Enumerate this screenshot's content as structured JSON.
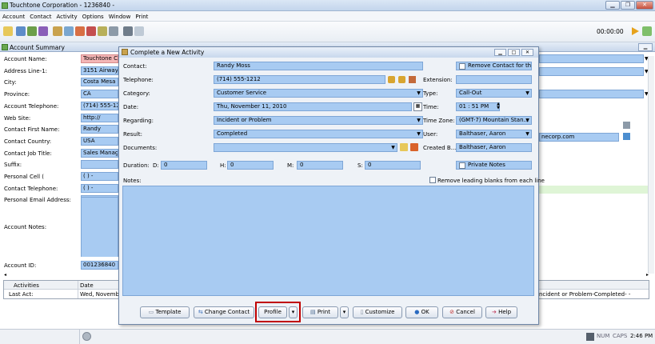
{
  "window": {
    "title": "Touchtone Corporation - 1236840 -"
  },
  "menu": [
    "Account",
    "Contact",
    "Activity",
    "Options",
    "Window",
    "Print"
  ],
  "toolbar": {
    "timer": "00:00:00"
  },
  "summary": {
    "title": "Account Summary",
    "fields": [
      {
        "label": "Account Name:",
        "value": "Touchtone Co"
      },
      {
        "label": "Address Line-1:",
        "value": "3151 Airway A"
      },
      {
        "label": "City:",
        "value": "Costa Mesa"
      },
      {
        "label": "Province:",
        "value": "CA"
      },
      {
        "label": "Account Telephone:",
        "value": "(714) 555-121"
      },
      {
        "label": "Web Site:",
        "value": "http://"
      },
      {
        "label": "Contact First Name:",
        "value": "Randy"
      },
      {
        "label": "Contact Country:",
        "value": "USA"
      },
      {
        "label": "Contact Job Title:",
        "value": "Sales Manager"
      },
      {
        "label": "Suffix:",
        "value": ""
      },
      {
        "label": "Personal Cell (",
        "value": "( )  -"
      },
      {
        "label": "Contact Telephone:",
        "value": "( )  -"
      },
      {
        "label": "Personal Email Address:",
        "value": ""
      }
    ],
    "notes_label": "Account Notes:",
    "account_id_label": "Account ID:",
    "account_id": "001236840",
    "email_partial": "necorp.com",
    "activities_header": "Activities",
    "date_header": "Date",
    "last_act_label": "Last Act:",
    "last_act_date": "Wed, Novembe",
    "last_act_desc": "ncident or Problem-Completed- -"
  },
  "dialog": {
    "title": "Complete a New Activity",
    "contact_label": "Contact:",
    "contact": "Randy Moss",
    "remove_contact": "Remove Contact for th...",
    "telephone_label": "Telephone:",
    "telephone": "(714) 555-1212",
    "extension_label": "Extension:",
    "category_label": "Category:",
    "category": "Customer Service",
    "type_label": "Type:",
    "type": "Call-Out",
    "date_label": "Date:",
    "date": "Thu, November 11, 2010",
    "time_label": "Time:",
    "time": "01 : 51   PM",
    "regarding_label": "Regarding:",
    "regarding": "Incident or Problem",
    "timezone_label": "Time Zone:",
    "timezone": "(GMT-7) Mountain Stan...",
    "result_label": "Result:",
    "result": "Completed",
    "user_label": "User:",
    "user": "Balthaser, Aaron",
    "documents_label": "Documents:",
    "created_label": "Created B...",
    "created": "Balthaser, Aaron",
    "duration_label": "Duration:",
    "d_label": "D:",
    "d": "0",
    "h_label": "H:",
    "h": "0",
    "m_label": "M:",
    "m": "0",
    "s_label": "S:",
    "s": "0",
    "private_notes": "Private Notes",
    "notes_label": "Notes:",
    "remove_blanks": "Remove leading blanks from each line",
    "buttons": {
      "template": "Template",
      "change_contact": "Change Contact",
      "profile": "Profile",
      "print": "Print",
      "customize": "Customize",
      "ok": "OK",
      "cancel": "Cancel",
      "help": "Help"
    }
  },
  "status": {
    "num": "NUM",
    "caps": "CAPS",
    "time": "2:46 PM"
  },
  "colors": {
    "field": "#a8cbf2",
    "highlight": "#c00000"
  }
}
